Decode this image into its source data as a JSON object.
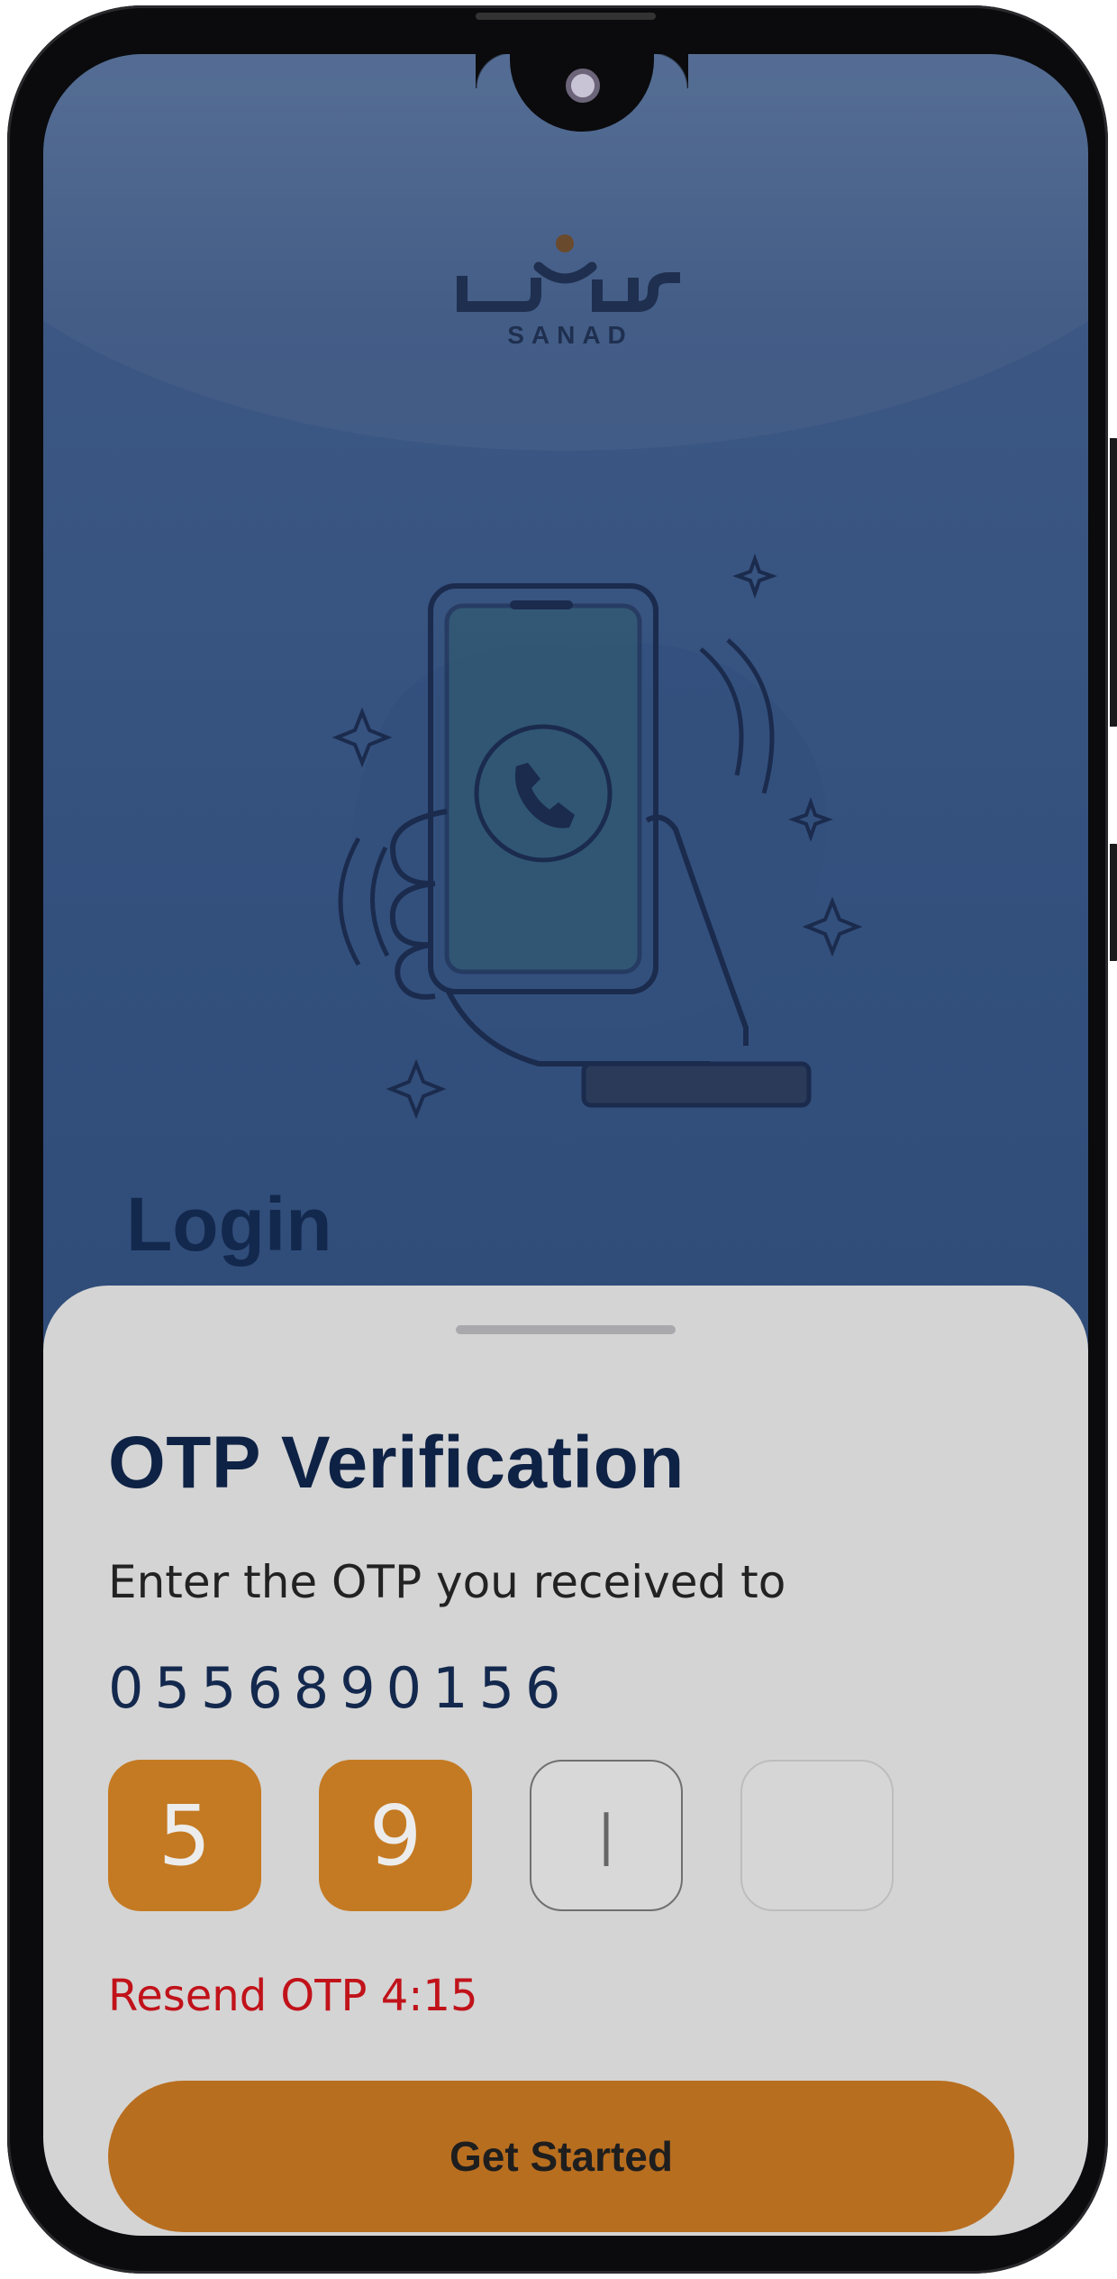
{
  "app": {
    "logo_text": "SANAD",
    "screen_title": "Login"
  },
  "otp_sheet": {
    "title": "OTP Verification",
    "subtitle": "Enter the OTP you received to",
    "phone_number": "0556890156",
    "digits": [
      "5",
      "9",
      "|",
      ""
    ],
    "resend_label": "Resend OTP 4:15",
    "submit_label": "Get Started"
  },
  "colors": {
    "background_overlay": "#2e4a76",
    "sheet_background": "#d4d4d4",
    "accent": "#c47a22",
    "title_text": "#0e2245",
    "error_text": "#c1121a"
  },
  "icons": [
    "phone-call-icon",
    "sparkle-icon",
    "camera-icon"
  ]
}
